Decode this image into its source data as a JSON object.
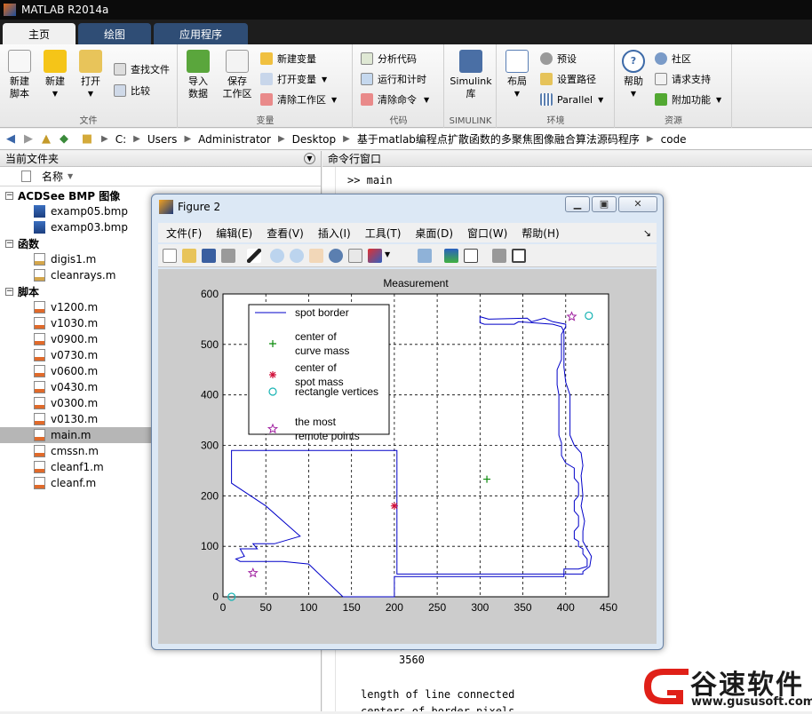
{
  "window": {
    "title": "MATLAB R2014a"
  },
  "tabs": [
    "主页",
    "绘图",
    "应用程序"
  ],
  "ribbon": {
    "file": {
      "caption": "文件",
      "new_script": "新建\n脚本",
      "new": "新建",
      "open": "打开",
      "find_files": "查找文件",
      "compare": "比较"
    },
    "variable": {
      "caption": "变量",
      "import": "导入\n数据",
      "save_ws": "保存\n工作区",
      "new_var": "新建变量",
      "open_var": "打开变量",
      "clear_ws": "清除工作区"
    },
    "code": {
      "caption": "代码",
      "analyze": "分析代码",
      "run_time": "运行和计时",
      "clear_cmd": "清除命令"
    },
    "simulink": {
      "caption": "SIMULINK",
      "lib": "Simulink\n库"
    },
    "env": {
      "caption": "环境",
      "layout": "布局",
      "prefs": "预设",
      "set_path": "设置路径",
      "parallel": "Parallel"
    },
    "resources": {
      "caption": "资源",
      "help": "帮助",
      "community": "社区",
      "support": "请求支持",
      "addons": "附加功能"
    }
  },
  "address": {
    "segments": [
      "C:",
      "Users",
      "Administrator",
      "Desktop",
      "基于matlab编程点扩散函数的多聚焦图像融合算法源码程序",
      "code"
    ]
  },
  "current_folder": {
    "title": "当前文件夹",
    "col_name": "名称",
    "groups": [
      {
        "label": "ACDSee BMP 图像",
        "items": [
          "examp05.bmp",
          "examp03.bmp"
        ]
      },
      {
        "label": "函数",
        "items": [
          "digis1.m",
          "cleanrays.m"
        ]
      },
      {
        "label": "脚本",
        "items": [
          "v1200.m",
          "v1030.m",
          "v0900.m",
          "v0730.m",
          "v0600.m",
          "v0430.m",
          "v0300.m",
          "v0130.m",
          "main.m",
          "cmssn.m",
          "cleanf1.m",
          "cleanf.m"
        ]
      }
    ],
    "selected": "main.m"
  },
  "command_window": {
    "title": "命令行窗口",
    "prompt_line": ">> main",
    "output_value": "3560",
    "output_line1": "length of line connected",
    "output_line2": "centers of border pixels"
  },
  "figure": {
    "title": "Figure 2",
    "menu": [
      "文件(F)",
      "编辑(E)",
      "查看(V)",
      "插入(I)",
      "工具(T)",
      "桌面(D)",
      "窗口(W)",
      "帮助(H)"
    ],
    "dock_symbol": "↘"
  },
  "chart_data": {
    "type": "line",
    "title": "Measurement",
    "xlim": [
      0,
      450
    ],
    "ylim": [
      0,
      600
    ],
    "xticks": [
      0,
      50,
      100,
      150,
      200,
      250,
      300,
      350,
      400,
      450
    ],
    "yticks": [
      0,
      100,
      200,
      300,
      400,
      500,
      600
    ],
    "grid": true,
    "legend_position": "top-left",
    "series": [
      {
        "name": "spot border",
        "style": "line",
        "color": "#0000c8",
        "points": [
          [
            140,
            0
          ],
          [
            200,
            0
          ],
          [
            200,
            40
          ],
          [
            398,
            40
          ],
          [
            398,
            55
          ],
          [
            415,
            55
          ],
          [
            425,
            60
          ],
          [
            425,
            75
          ],
          [
            420,
            85
          ],
          [
            420,
            95
          ],
          [
            415,
            100
          ],
          [
            415,
            110
          ],
          [
            410,
            115
          ],
          [
            410,
            130
          ],
          [
            415,
            140
          ],
          [
            415,
            160
          ],
          [
            410,
            170
          ],
          [
            410,
            190
          ],
          [
            415,
            200
          ],
          [
            415,
            225
          ],
          [
            410,
            235
          ],
          [
            410,
            255
          ],
          [
            400,
            265
          ],
          [
            395,
            280
          ],
          [
            395,
            305
          ],
          [
            392,
            320
          ],
          [
            392,
            400
          ],
          [
            390,
            420
          ],
          [
            390,
            450
          ],
          [
            395,
            470
          ],
          [
            395,
            520
          ],
          [
            400,
            535
          ],
          [
            400,
            540
          ],
          [
            385,
            545
          ],
          [
            375,
            552
          ],
          [
            360,
            545
          ],
          [
            355,
            552
          ],
          [
            310,
            550
          ],
          [
            300,
            555
          ],
          [
            300,
            543
          ],
          [
            305,
            540
          ],
          [
            340,
            540
          ],
          [
            345,
            545
          ],
          [
            385,
            540
          ],
          [
            395,
            535
          ],
          [
            398,
            525
          ],
          [
            398,
            455
          ],
          [
            400,
            425
          ],
          [
            405,
            400
          ],
          [
            405,
            320
          ],
          [
            410,
            300
          ],
          [
            418,
            285
          ],
          [
            420,
            260
          ],
          [
            418,
            240
          ],
          [
            420,
            200
          ],
          [
            418,
            180
          ],
          [
            422,
            150
          ],
          [
            420,
            130
          ],
          [
            420,
            110
          ],
          [
            425,
            95
          ],
          [
            430,
            80
          ],
          [
            428,
            60
          ],
          [
            420,
            50
          ],
          [
            420,
            45
          ],
          [
            203,
            45
          ],
          [
            203,
            290
          ],
          [
            10,
            290
          ],
          [
            10,
            225
          ],
          [
            50,
            180
          ],
          [
            90,
            120
          ],
          [
            60,
            105
          ],
          [
            35,
            105
          ],
          [
            40,
            95
          ],
          [
            20,
            95
          ],
          [
            25,
            80
          ],
          [
            15,
            75
          ],
          [
            20,
            70
          ],
          [
            70,
            70
          ],
          [
            100,
            65
          ],
          [
            140,
            0
          ]
        ]
      },
      {
        "name": "center of\ncurve mass",
        "style": "marker",
        "marker": "+",
        "color": "#0a8a0a",
        "points": [
          [
            308,
            233
          ]
        ]
      },
      {
        "name": "center of\nspot mass",
        "style": "marker",
        "marker": "*",
        "color": "#d0103a",
        "points": [
          [
            200,
            180
          ]
        ]
      },
      {
        "name": "rectangle vertices",
        "style": "marker",
        "marker": "o",
        "color": "#16b3b3",
        "points": [
          [
            10,
            0
          ],
          [
            427,
            557
          ]
        ]
      },
      {
        "name": "the most\nremote points",
        "style": "marker",
        "marker": "star",
        "color": "#a020a0",
        "points": [
          [
            35,
            47
          ],
          [
            407,
            555
          ]
        ]
      }
    ]
  },
  "watermark": {
    "brand": "谷速软件",
    "url": "www.gususoft.com",
    "colors": {
      "red": "#e02018",
      "dark": "#1b1b1b"
    }
  }
}
